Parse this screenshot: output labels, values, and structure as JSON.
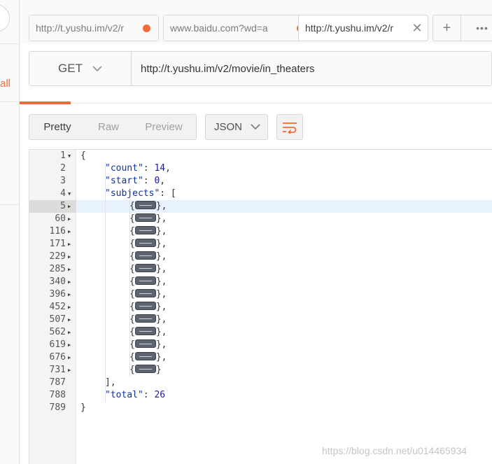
{
  "sidebar": {
    "partial_label": "all"
  },
  "tabs": [
    {
      "label": "http://t.yushu.im/v2/r",
      "unsaved": true,
      "active": false
    },
    {
      "label": "www.baidu.com?wd=a",
      "unsaved": true,
      "active": false
    },
    {
      "label": "http://t.yushu.im/v2/r",
      "unsaved": false,
      "active": true
    }
  ],
  "tab_actions": {
    "add_label": "+",
    "more_label": "•••"
  },
  "request": {
    "method": "GET",
    "url": "http://t.yushu.im/v2/movie/in_theaters"
  },
  "response": {
    "formats": [
      "Pretty",
      "Raw",
      "Preview"
    ],
    "selected_format": "Pretty",
    "language": "JSON",
    "lines": [
      {
        "n": "1",
        "fold": "down",
        "indent": 0,
        "parts": [
          [
            "p",
            "{"
          ]
        ]
      },
      {
        "n": "2",
        "fold": "",
        "indent": 1,
        "parts": [
          [
            "k",
            "\"count\""
          ],
          [
            "p",
            ": "
          ],
          [
            "v",
            "14"
          ],
          [
            "p",
            ","
          ]
        ]
      },
      {
        "n": "3",
        "fold": "",
        "indent": 1,
        "parts": [
          [
            "k",
            "\"start\""
          ],
          [
            "p",
            ": "
          ],
          [
            "v",
            "0"
          ],
          [
            "p",
            ","
          ]
        ]
      },
      {
        "n": "4",
        "fold": "down",
        "indent": 1,
        "parts": [
          [
            "k",
            "\"subjects\""
          ],
          [
            "p",
            ": ["
          ]
        ]
      },
      {
        "n": "5",
        "fold": "right",
        "indent": 2,
        "collapsed": true,
        "comma": true
      },
      {
        "n": "60",
        "fold": "right",
        "indent": 2,
        "collapsed": true,
        "comma": true
      },
      {
        "n": "116",
        "fold": "right",
        "indent": 2,
        "collapsed": true,
        "comma": true
      },
      {
        "n": "171",
        "fold": "right",
        "indent": 2,
        "collapsed": true,
        "comma": true
      },
      {
        "n": "229",
        "fold": "right",
        "indent": 2,
        "collapsed": true,
        "comma": true
      },
      {
        "n": "285",
        "fold": "right",
        "indent": 2,
        "collapsed": true,
        "comma": true
      },
      {
        "n": "340",
        "fold": "right",
        "indent": 2,
        "collapsed": true,
        "comma": true
      },
      {
        "n": "396",
        "fold": "right",
        "indent": 2,
        "collapsed": true,
        "comma": true
      },
      {
        "n": "452",
        "fold": "right",
        "indent": 2,
        "collapsed": true,
        "comma": true
      },
      {
        "n": "507",
        "fold": "right",
        "indent": 2,
        "collapsed": true,
        "comma": true
      },
      {
        "n": "562",
        "fold": "right",
        "indent": 2,
        "collapsed": true,
        "comma": true
      },
      {
        "n": "619",
        "fold": "right",
        "indent": 2,
        "collapsed": true,
        "comma": true
      },
      {
        "n": "676",
        "fold": "right",
        "indent": 2,
        "collapsed": true,
        "comma": true
      },
      {
        "n": "731",
        "fold": "right",
        "indent": 2,
        "collapsed": true,
        "comma": false
      },
      {
        "n": "787",
        "fold": "",
        "indent": 1,
        "parts": [
          [
            "p",
            "],"
          ]
        ]
      },
      {
        "n": "788",
        "fold": "",
        "indent": 1,
        "parts": [
          [
            "k",
            "\"total\""
          ],
          [
            "p",
            ": "
          ],
          [
            "v",
            "26"
          ]
        ]
      },
      {
        "n": "789",
        "fold": "",
        "indent": 0,
        "parts": [
          [
            "p",
            "}"
          ]
        ]
      }
    ]
  },
  "watermark": "https://blog.csdn.net/u014465934",
  "colors": {
    "accent": "#f26b3a",
    "json_key": "#0a33a8",
    "json_number": "#1a1aa6",
    "highlight": "#e8f2fc"
  }
}
